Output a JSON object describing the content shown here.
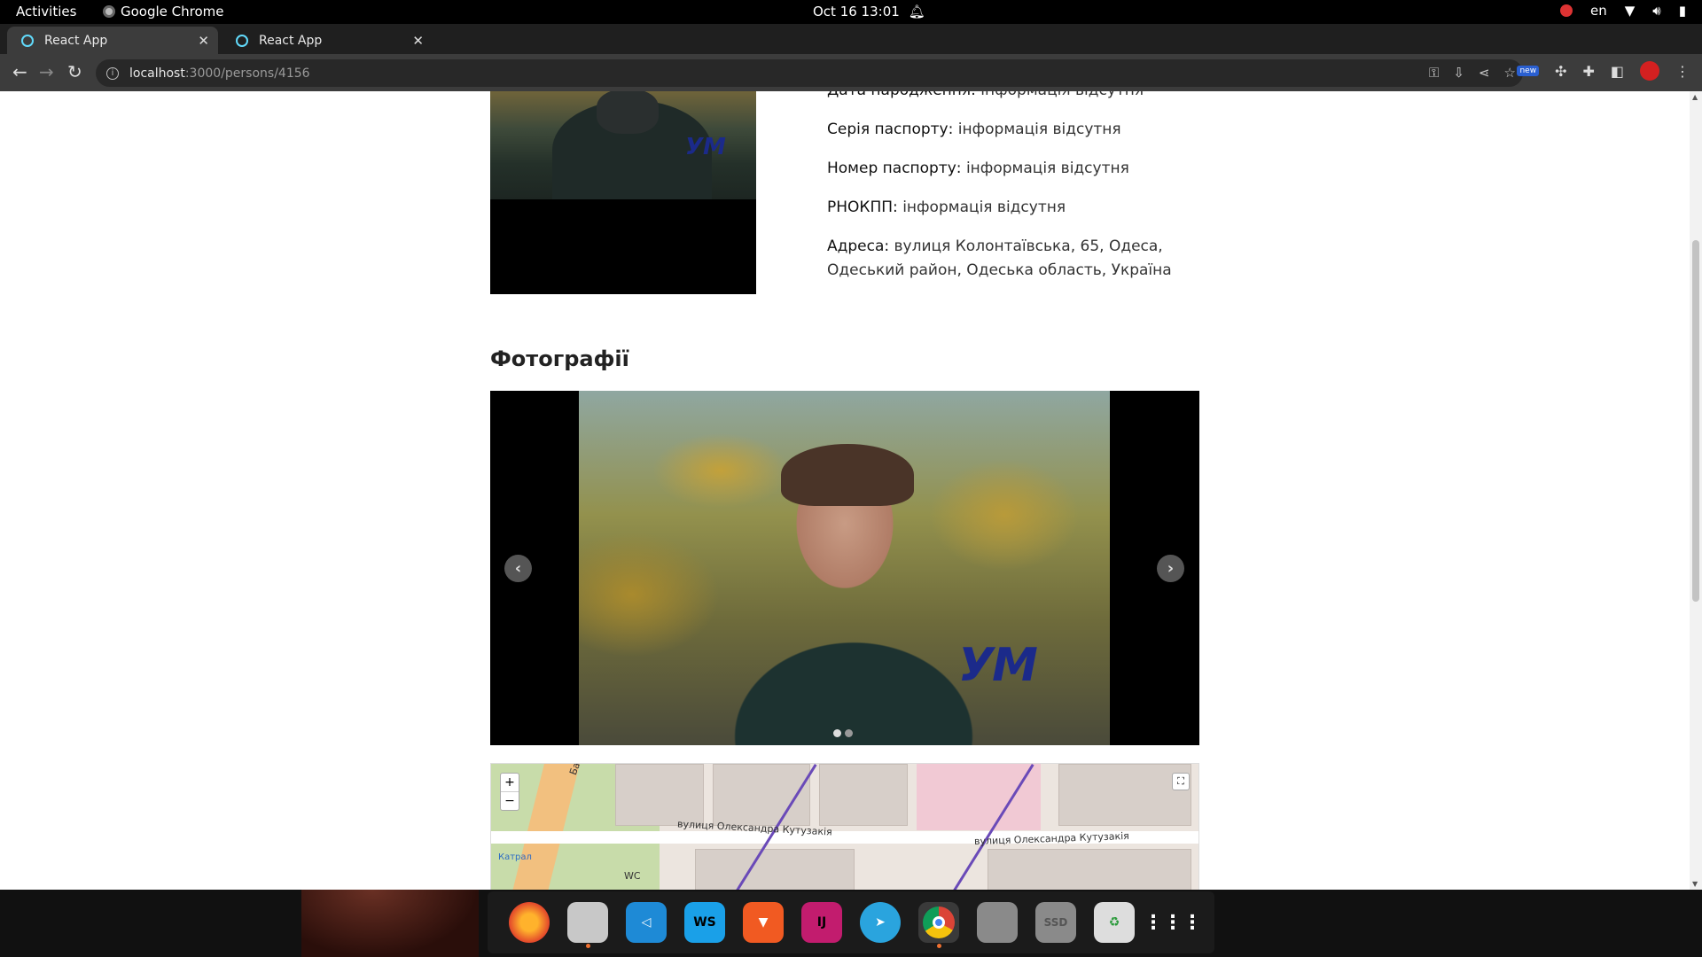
{
  "system_bar": {
    "activities": "Activities",
    "app_name": "Google Chrome",
    "clock": "Oct 16  13:01",
    "language": "en"
  },
  "tabs": [
    {
      "title": "React App",
      "active": true
    },
    {
      "title": "React App",
      "active": false
    }
  ],
  "address_bar": {
    "host": "localhost",
    "path": ":3000/persons/4156"
  },
  "extension_badge": "new",
  "person_info": [
    {
      "label": "Дата народження:",
      "value": "інформація відсутня"
    },
    {
      "label": "Серія паспорту:",
      "value": "інформація відсутня"
    },
    {
      "label": "Номер паспорту:",
      "value": "інформація відсутня"
    },
    {
      "label": "РНОКПП:",
      "value": "інформація відсутня"
    },
    {
      "label": "Адреса:",
      "value": "вулиця Колонтаївська, 65, Одеса, Одеський район, Одеська область, Україна"
    }
  ],
  "photos_section": {
    "title": "Фотографії",
    "watermark": "УМ",
    "slide_count": 2,
    "active_slide": 1
  },
  "map": {
    "zoom_in": "+",
    "zoom_out": "−",
    "street_left": "вулиця Олександра Кутузакія",
    "street_right": "вулиця Олександра Кутузакія",
    "side_street": "Балківсь",
    "fuel_label": "Катрал",
    "wc_label": "WC"
  },
  "dock": [
    {
      "name": "firefox",
      "label": ""
    },
    {
      "name": "files",
      "label": ""
    },
    {
      "name": "vscode",
      "label": ""
    },
    {
      "name": "webstorm",
      "label": "WS"
    },
    {
      "name": "brave",
      "label": ""
    },
    {
      "name": "intellij",
      "label": "IJ"
    },
    {
      "name": "telegram",
      "label": ""
    },
    {
      "name": "chrome",
      "label": ""
    },
    {
      "name": "drive1",
      "label": ""
    },
    {
      "name": "drive-ssd",
      "label": "SSD"
    },
    {
      "name": "trash",
      "label": ""
    },
    {
      "name": "app-grid",
      "label": ""
    }
  ]
}
